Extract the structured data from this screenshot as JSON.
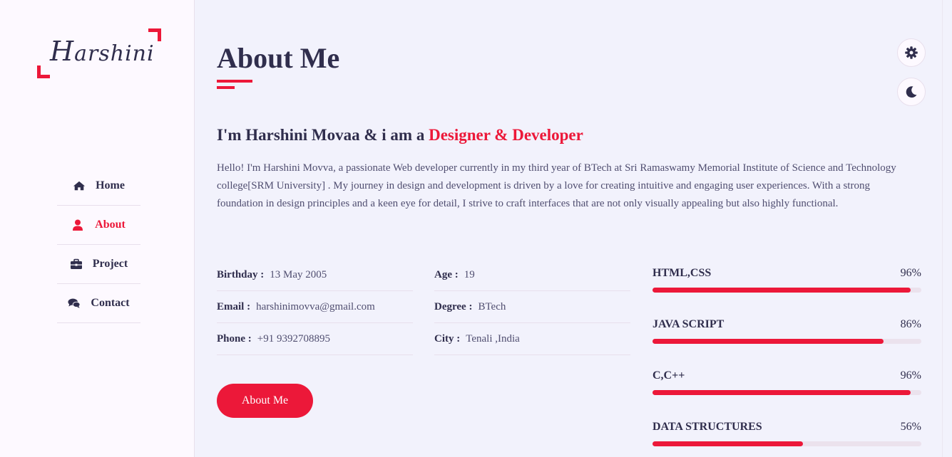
{
  "logo": {
    "text_first": "H",
    "text_rest": "arshini"
  },
  "nav": {
    "items": [
      {
        "label": "Home",
        "icon": "home-icon"
      },
      {
        "label": "About",
        "icon": "user-icon",
        "active": true
      },
      {
        "label": "Project",
        "icon": "briefcase-icon"
      },
      {
        "label": "Contact",
        "icon": "comments-icon"
      }
    ]
  },
  "about": {
    "title": "About Me",
    "headline_prefix": "I'm Harshini Movaa & i am a ",
    "headline_accent": "Designer & Developer",
    "intro": "Hello! I'm Harshini Movva, a passionate Web developer currently in my third year of BTech at Sri Ramaswamy Memorial Institute of Science and Technology college[SRM University] . My journey in design and development is driven by a love for creating intuitive and engaging user experiences. With a strong foundation in design principles and a keen eye for detail, I strive to craft interfaces that are not only visually appealing but also highly functional.",
    "info_left": [
      {
        "key": "Birthday :",
        "value": "13 May 2005"
      },
      {
        "key": "Email :",
        "value": "harshinimovva@gmail.com"
      },
      {
        "key": "Phone :",
        "value": "+91 9392708895"
      }
    ],
    "info_right": [
      {
        "key": "Age :",
        "value": "19"
      },
      {
        "key": "Degree :",
        "value": "BTech"
      },
      {
        "key": "City :",
        "value": "Tenali ,India"
      }
    ],
    "button_label": "About Me"
  },
  "skills": [
    {
      "name": "HTML,CSS",
      "percent_label": "96%",
      "level": 0.96
    },
    {
      "name": "JAVA SCRIPT",
      "percent_label": "86%",
      "level": 0.86
    },
    {
      "name": "C,C++",
      "percent_label": "96%",
      "level": 0.96
    },
    {
      "name": "DATA STRUCTURES",
      "percent_label": "56%",
      "level": 0.56
    }
  ],
  "colors": {
    "accent": "#ec1839",
    "text": "#302e4d",
    "background": "#f2f2fc",
    "sidebar": "#fdf9ff"
  },
  "controls": {
    "settings_icon": "gear-icon",
    "theme_icon": "moon-icon"
  }
}
